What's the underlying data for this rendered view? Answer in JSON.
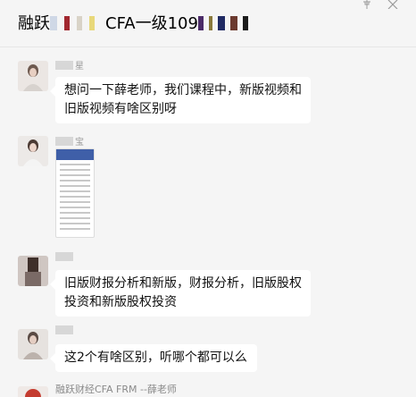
{
  "window": {
    "title_prefix": "融跃",
    "title_mid": "CFA一级109",
    "pin_icon": "pin-icon",
    "close_icon": "close-icon"
  },
  "messages": [
    {
      "sender": "星",
      "text": "想问一下薛老师，我们课程中，新版视频和旧版视频有啥区别呀"
    },
    {
      "sender": "宝",
      "attachment": "screenshot-image"
    },
    {
      "sender": "",
      "text": "旧版财报分析和新版，财报分析，旧版股权投资和新版股权投资"
    },
    {
      "sender": "",
      "text": "这2个有啥区别，听哪个都可以么"
    }
  ],
  "footer": {
    "sender": "融跃财经CFA FRM --薛老师"
  },
  "colors": {
    "background": "#f5f5f5",
    "bubble": "#ffffff",
    "text": "#111111",
    "sender": "#9a9a9a"
  }
}
